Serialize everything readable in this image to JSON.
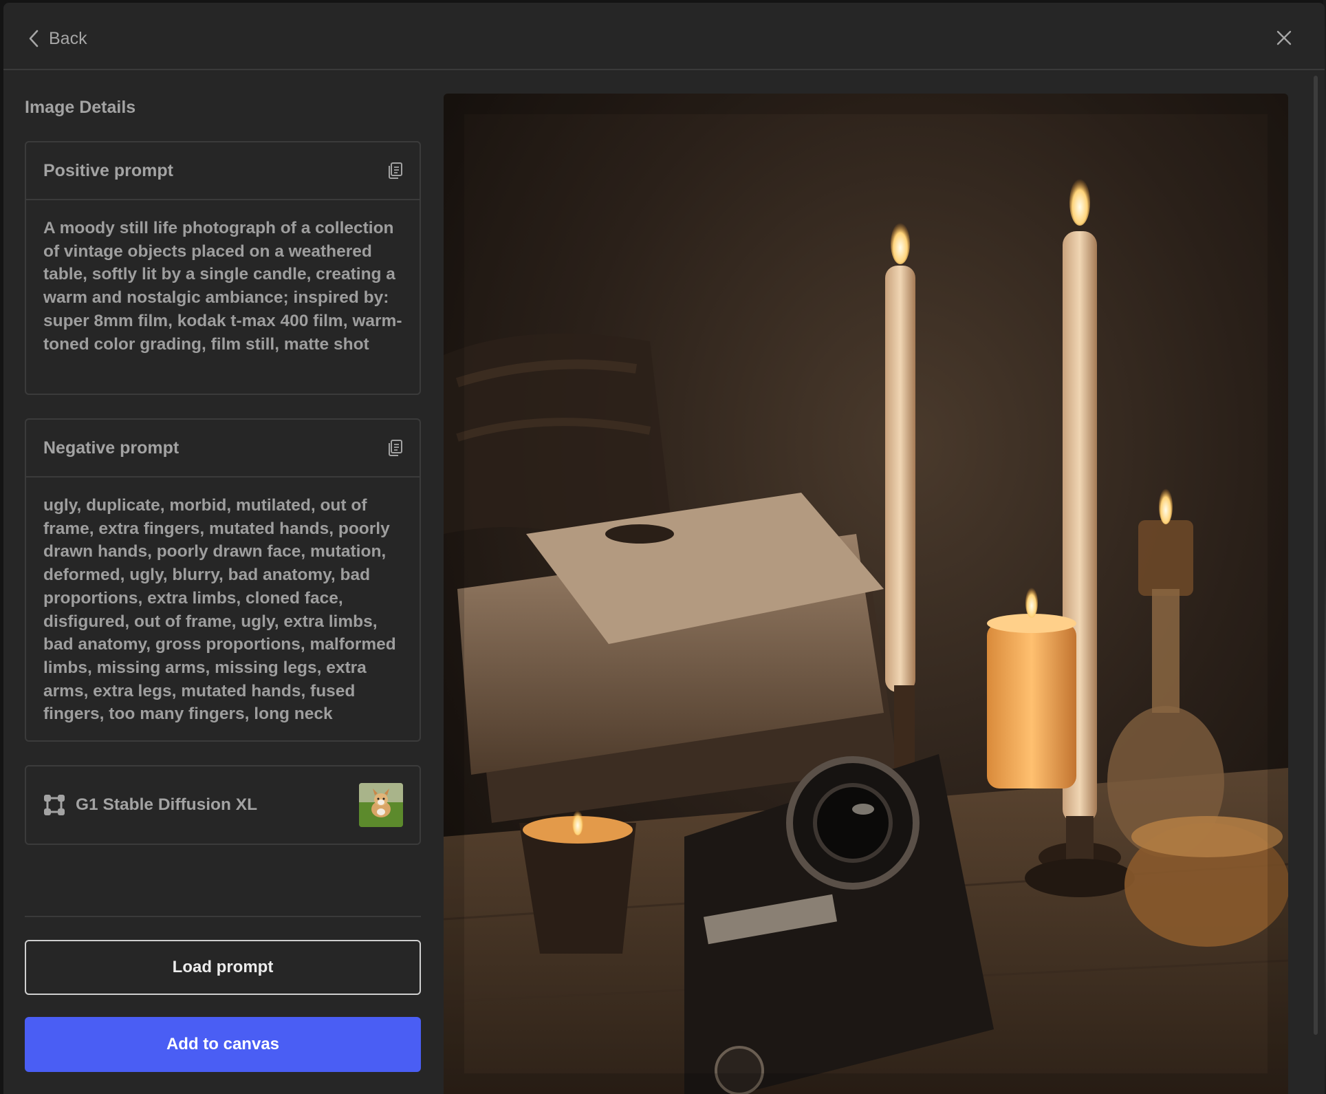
{
  "header": {
    "back_label": "Back",
    "back_icon": "chevron-left-icon",
    "close_icon": "close-icon"
  },
  "panel": {
    "title": "Image Details",
    "positive": {
      "title": "Positive prompt",
      "text": "A moody still life photograph of a collection of vintage objects placed on a weathered table, softly lit by a single candle, creating a warm and nostalgic ambiance; inspired by: super 8mm film, kodak t-max 400 film, warm-toned color grading, film still, matte shot",
      "icon": "copy-icon"
    },
    "negative": {
      "title": "Negative prompt",
      "text": "ugly, duplicate, morbid, mutilated, out of frame, extra fingers, mutated hands, poorly drawn hands, poorly drawn face, mutation, deformed, ugly, blurry, bad anatomy, bad proportions, extra limbs, cloned face, disfigured, out of frame, ugly, extra limbs, bad anatomy, gross proportions, malformed limbs, missing arms, missing legs, extra arms, extra legs, mutated hands, fused fingers, too many fingers, long neck",
      "icon": "copy-icon"
    },
    "model": {
      "name": "G1 Stable Diffusion XL",
      "icon": "model-node-icon"
    },
    "load_button": "Load prompt",
    "add_button": "Add to canvas"
  },
  "colors": {
    "background": "#262626",
    "accent": "#4a5ef4",
    "border": "#3b3b3b"
  }
}
